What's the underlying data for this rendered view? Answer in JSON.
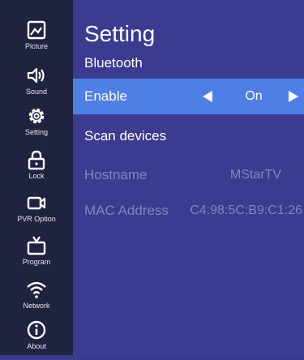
{
  "sidebar": {
    "items": [
      {
        "label": "Picture",
        "icon": "picture-icon"
      },
      {
        "label": "Sound",
        "icon": "speaker-icon"
      },
      {
        "label": "Setting",
        "icon": "gear-icon"
      },
      {
        "label": "Lock",
        "icon": "lock-icon"
      },
      {
        "label": "PVR Option",
        "icon": "camera-icon"
      },
      {
        "label": "Program",
        "icon": "tv-icon"
      },
      {
        "label": "Network",
        "icon": "wifi-icon"
      },
      {
        "label": "About",
        "icon": "info-icon"
      }
    ]
  },
  "main": {
    "title": "Setting",
    "section": "Bluetooth",
    "rows": [
      {
        "label": "Enable",
        "value": "On"
      },
      {
        "label": "Scan devices"
      },
      {
        "label": "Hostname",
        "value": "MStarTV"
      },
      {
        "label": "MAC Address",
        "value": "C4:98:5C:B9:C1:26"
      }
    ]
  },
  "colors": {
    "sidebar_bg": "#1f2340",
    "main_bg": "#3b3b90",
    "selected_row": "#4f7fe6",
    "disabled_text": "#7f86be"
  }
}
